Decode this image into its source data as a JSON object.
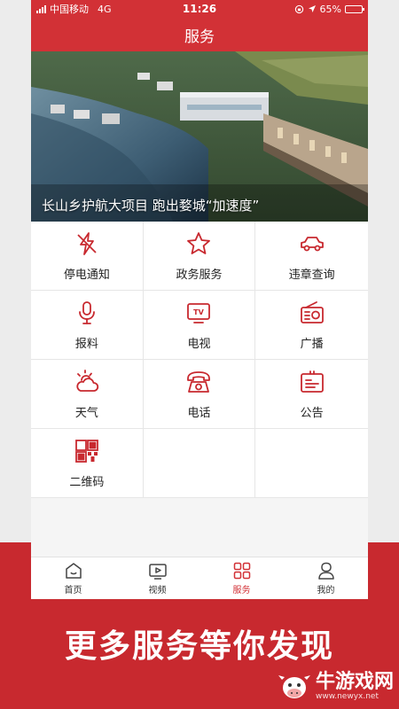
{
  "status_bar": {
    "carrier": "中国移动",
    "network": "4G",
    "time": "11:26",
    "battery": "65%",
    "battery_level": 0.65
  },
  "header": {
    "title": "服务"
  },
  "banner": {
    "caption": "长山乡护航大项目 跑出婺城“加速度”"
  },
  "services": [
    {
      "label": "停电通知",
      "icon": "power-outage-icon"
    },
    {
      "label": "政务服务",
      "icon": "star-icon"
    },
    {
      "label": "违章查询",
      "icon": "car-icon"
    },
    {
      "label": "报料",
      "icon": "microphone-icon"
    },
    {
      "label": "电视",
      "icon": "tv-icon"
    },
    {
      "label": "广播",
      "icon": "radio-icon"
    },
    {
      "label": "天气",
      "icon": "weather-icon"
    },
    {
      "label": "电话",
      "icon": "telephone-icon"
    },
    {
      "label": "公告",
      "icon": "notice-icon"
    },
    {
      "label": "二维码",
      "icon": "qr-code-icon"
    }
  ],
  "tabs": [
    {
      "label": "首页",
      "icon": "home-icon",
      "active": false
    },
    {
      "label": "视频",
      "icon": "video-icon",
      "active": false
    },
    {
      "label": "服务",
      "icon": "grid-icon",
      "active": true
    },
    {
      "label": "我的",
      "icon": "profile-icon",
      "active": false
    }
  ],
  "tagline": "更多服务等你发现",
  "watermark": {
    "name": "牛游戏网",
    "url": "www.newyx.net"
  },
  "colors": {
    "accent": "#d23136",
    "promo_background": "#c8292f",
    "icon_color": "#c8292f"
  }
}
